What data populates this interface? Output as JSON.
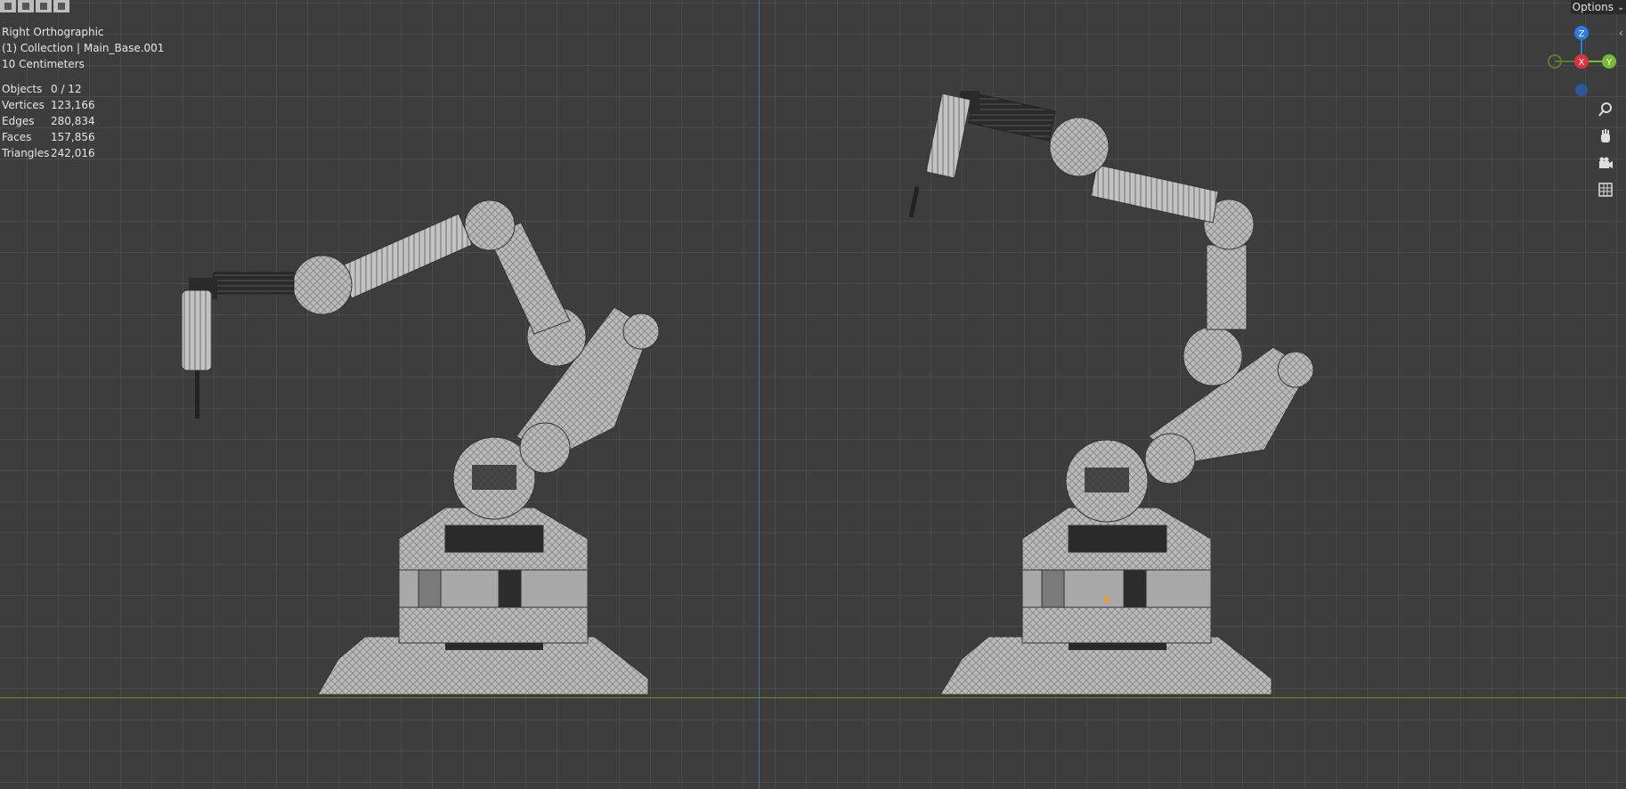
{
  "header_icons": [
    "select-box-icon",
    "select-mode-icon",
    "select-mode-icon-2",
    "select-mode-icon-3"
  ],
  "overlay": {
    "view_name": "Right Orthographic",
    "collection": "(1) Collection | Main_Base.001",
    "grid_scale": "10 Centimeters"
  },
  "stats": [
    {
      "label": "Objects",
      "value": "0 / 12"
    },
    {
      "label": "Vertices",
      "value": "123,166"
    },
    {
      "label": "Edges",
      "value": "280,834"
    },
    {
      "label": "Faces",
      "value": "157,856"
    },
    {
      "label": "Triangles",
      "value": "242,016"
    }
  ],
  "options": {
    "label": "Options"
  },
  "gizmo": {
    "z": "Z",
    "x": "X",
    "y": "Y",
    "z_color": "#2d7ae0",
    "x_color": "#e0323e",
    "y_color": "#7bb83a"
  },
  "nav_tools": [
    "zoom-icon",
    "hand-pan-icon",
    "camera-icon",
    "grid-ortho-icon"
  ],
  "colors": {
    "background": "#3d3d3d",
    "grid": "#4a4a4a",
    "mesh": "#bdbdbd",
    "mesh_dark": "#2a2a2a"
  }
}
